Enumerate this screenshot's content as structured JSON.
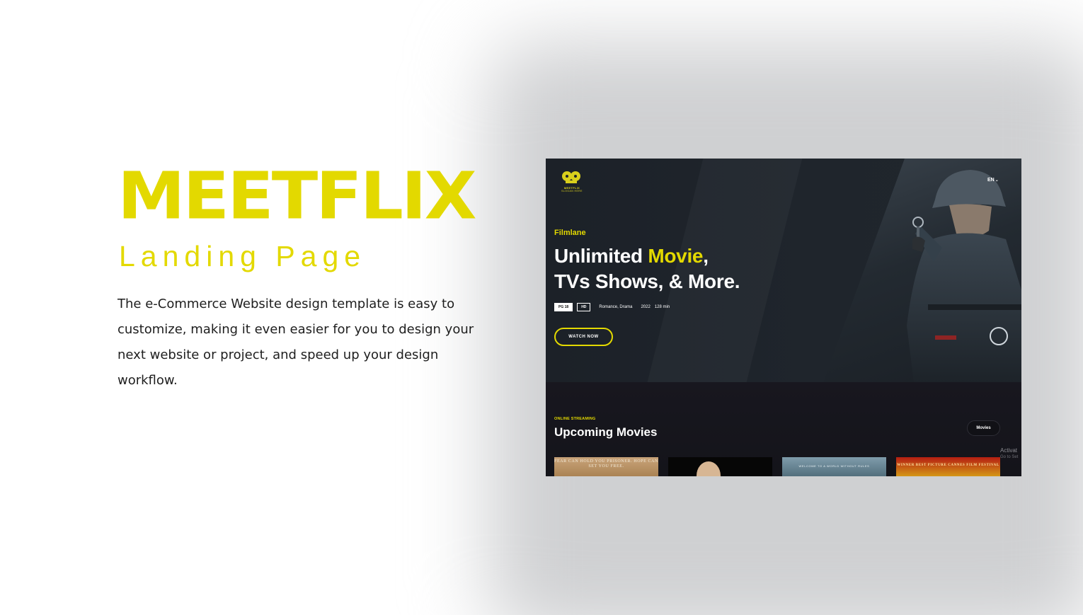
{
  "promo": {
    "title": "MEETFLIX",
    "subtitle": "Landing Page",
    "description": "The e-Commerce Website design template is easy to customize, making it even easier for you to design your next website or project, and speed up your design workflow."
  },
  "mockup": {
    "logo": {
      "name": "MEETFLIX",
      "tagline": "SLOGAN HERE"
    },
    "language": "EN",
    "hero": {
      "kicker": "Filmlane",
      "headline_line1_start": "Unlimited ",
      "headline_line1_highlight": "Movie",
      "headline_line1_end": ",",
      "headline_line2": "TVs Shows, & More.",
      "badges": [
        "PG 18",
        "HD"
      ],
      "genres": "Romance,  Drama",
      "year": "2022",
      "duration": "128 min",
      "cta": "WATCH NOW"
    },
    "section": {
      "eyebrow": "ONLINE STREAMING",
      "title": "Upcoming Movies",
      "filter_pill": "Movies"
    },
    "posters": [
      {
        "text": "FEAR CAN HOLD YOU PRISONER. HOPE CAN SET YOU FREE."
      },
      {
        "text": ""
      },
      {
        "text": "WELCOME TO A WORLD WITHOUT RULES"
      },
      {
        "text": "WINNER BEST PICTURE CANNES FILM FESTIVAL"
      }
    ],
    "watermark": {
      "line1": "Activat",
      "line2": "Go to Set"
    }
  },
  "colors": {
    "accent": "#e3d900",
    "hero_bg": "#1f252c",
    "lower_bg": "#16161c"
  }
}
